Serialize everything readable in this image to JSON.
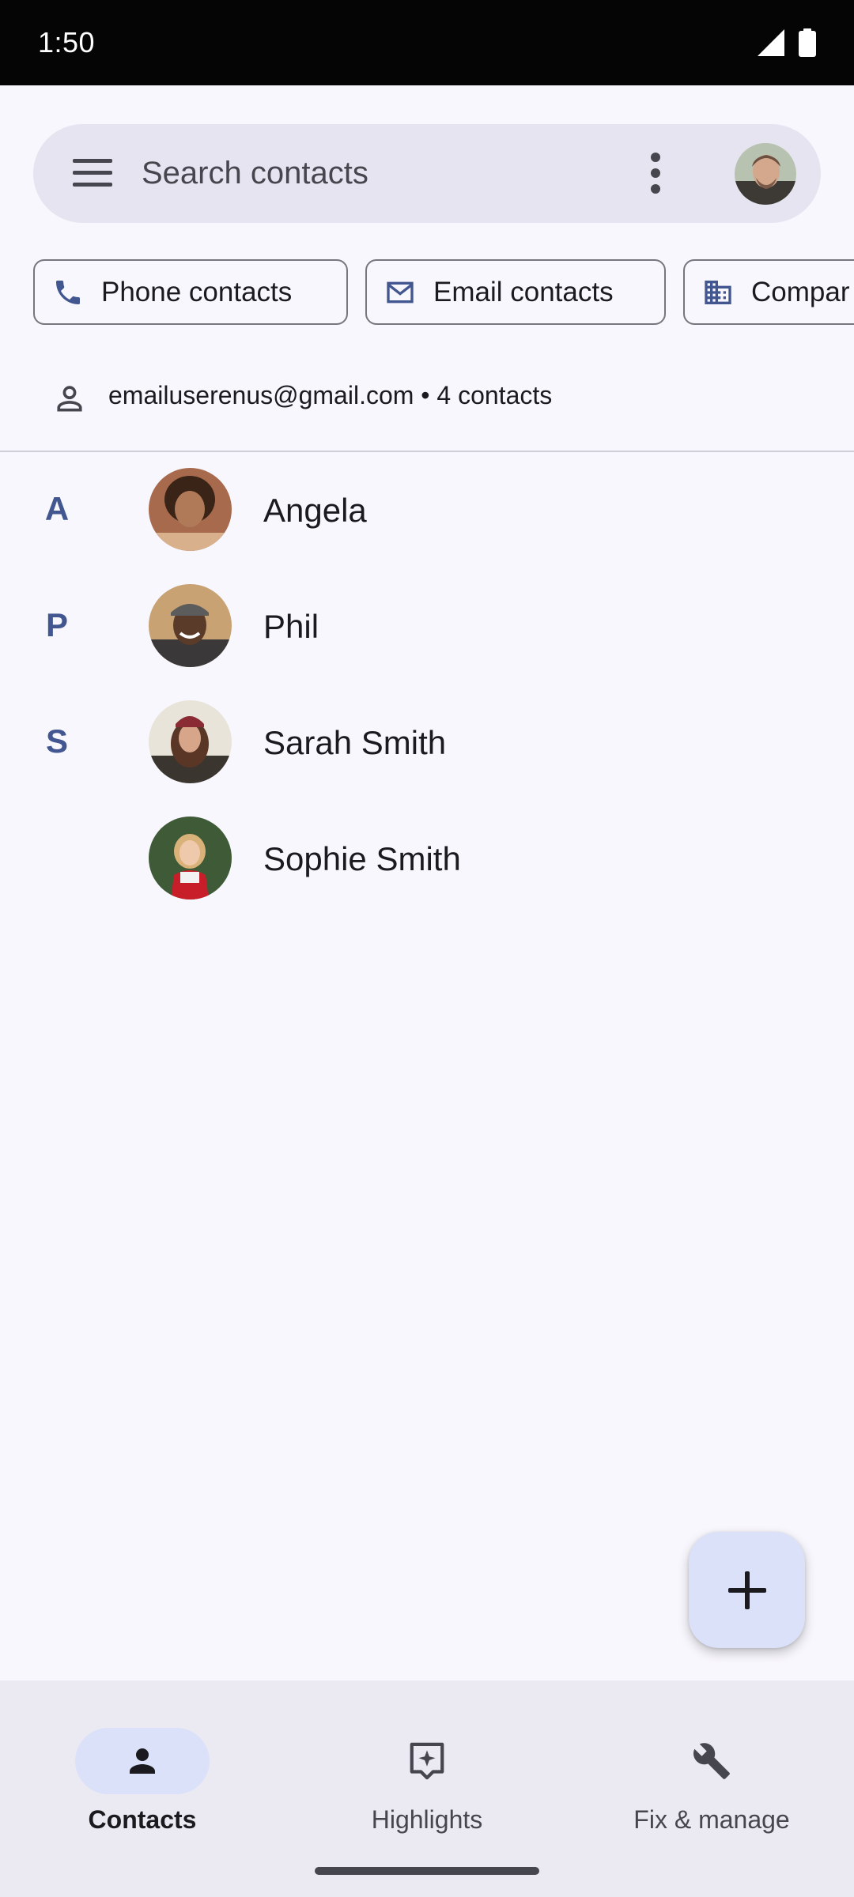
{
  "status_bar": {
    "time": "1:50",
    "icons": [
      "signal-icon",
      "battery-icon"
    ]
  },
  "search": {
    "placeholder": "Search contacts",
    "icons": [
      "menu-icon",
      "more-vert-icon",
      "account-avatar"
    ]
  },
  "filter_chips": [
    {
      "label": "Phone contacts",
      "icon": "phone-icon"
    },
    {
      "label": "Email contacts",
      "icon": "mail-icon"
    },
    {
      "label": "Compar",
      "icon": "business-icon"
    }
  ],
  "account": {
    "label": "emailuserenus@gmail.com • 4 contacts",
    "icon": "person-outline-icon"
  },
  "contacts": [
    {
      "letter": "A",
      "name": "Angela"
    },
    {
      "letter": "P",
      "name": "Phil"
    },
    {
      "letter": "S",
      "name": "Sarah Smith"
    },
    {
      "letter": "",
      "name": "Sophie Smith"
    }
  ],
  "fab": {
    "icon": "add-icon"
  },
  "bottom_nav": {
    "items": [
      {
        "label": "Contacts",
        "icon": "person-icon",
        "active": true
      },
      {
        "label": "Highlights",
        "icon": "highlights-icon",
        "active": false
      },
      {
        "label": "Fix & manage",
        "icon": "wrench-icon",
        "active": false
      }
    ]
  },
  "colors": {
    "background": "#f8f7fd",
    "search_bar": "#e5e4f0",
    "section_letter": "#42568f",
    "accent_container": "#dbe1f9",
    "nav_background": "#ebeaf3"
  }
}
